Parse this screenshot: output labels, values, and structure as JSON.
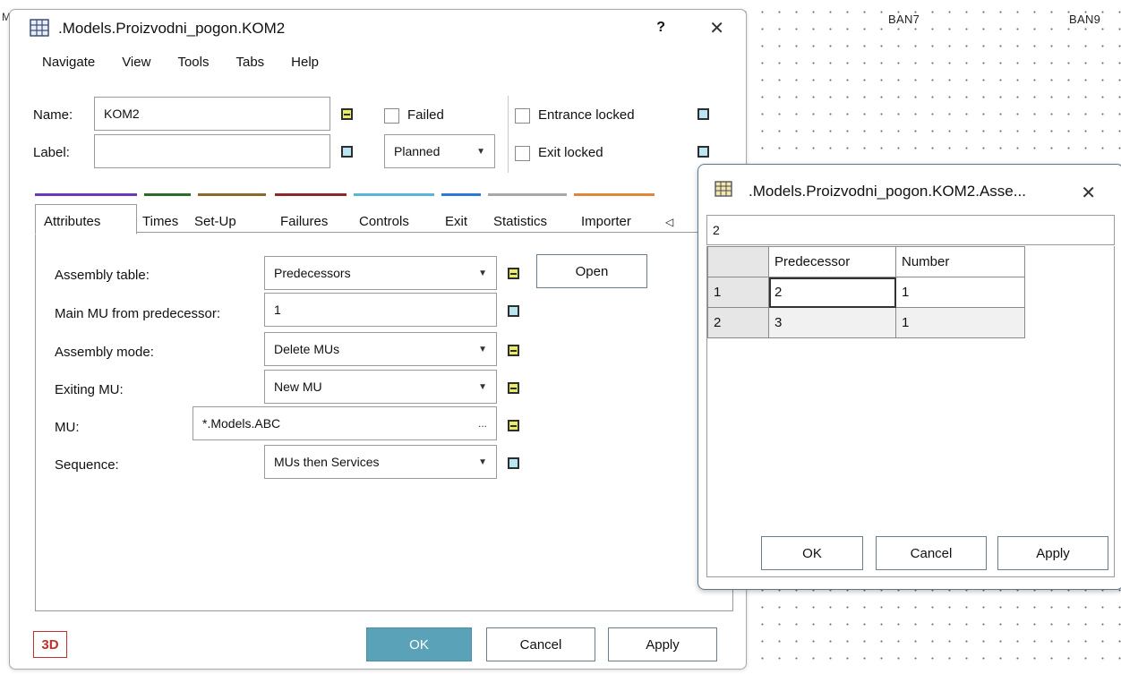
{
  "background": {
    "edge_letter": "M",
    "labels": [
      "BAN7",
      "BAN9"
    ]
  },
  "main_dialog": {
    "title": ".Models.Proizvodni_pogon.KOM2",
    "help_label": "?",
    "close_label": "✕",
    "menu": [
      "Navigate",
      "View",
      "Tools",
      "Tabs",
      "Help"
    ],
    "name_label": "Name:",
    "name_value": "KOM2",
    "label_label": "Label:",
    "label_value": "",
    "failed_label": "Failed",
    "planned_value": "Planned",
    "entrance_locked_label": "Entrance locked",
    "exit_locked_label": "Exit locked",
    "tabs": [
      {
        "label": "Attributes",
        "color": "#6a3ab6"
      },
      {
        "label": "Times",
        "color": "#2e6a2e"
      },
      {
        "label": "Set-Up",
        "color": "#8a6a2a"
      },
      {
        "label": "Failures",
        "color": "#8a2a2a"
      },
      {
        "label": "Controls",
        "color": "#59b7d6"
      },
      {
        "label": "Exit",
        "color": "#2e78d6"
      },
      {
        "label": "Statistics",
        "color": "#a8a8a8"
      },
      {
        "label": "Importer",
        "color": "#e0853a"
      }
    ],
    "tab_scroll_icon": "◁",
    "attributes": {
      "assembly_table_label": "Assembly table:",
      "assembly_table_value": "Predecessors",
      "open_button": "Open",
      "main_mu_label": "Main MU from predecessor:",
      "main_mu_value": "1",
      "assembly_mode_label": "Assembly mode:",
      "assembly_mode_value": "Delete MUs",
      "exiting_mu_label": "Exiting MU:",
      "exiting_mu_value": "New MU",
      "mu_label": "MU:",
      "mu_value": "*.Models.ABC",
      "mu_browse": "...",
      "sequence_label": "Sequence:",
      "sequence_value": "MUs then Services"
    },
    "badge_3d": "3D",
    "ok_button": "OK",
    "cancel_button": "Cancel",
    "apply_button": "Apply"
  },
  "assembly_dialog": {
    "title": ".Models.Proizvodni_pogon.KOM2.Asse...",
    "close_label": "✕",
    "cell_editor_value": "2",
    "columns": [
      "Predecessor",
      "Number"
    ],
    "rows": [
      {
        "index": "1",
        "predecessor": "2",
        "number": "1"
      },
      {
        "index": "2",
        "predecessor": "3",
        "number": "1"
      }
    ],
    "ok_button": "OK",
    "cancel_button": "Cancel",
    "apply_button": "Apply"
  }
}
